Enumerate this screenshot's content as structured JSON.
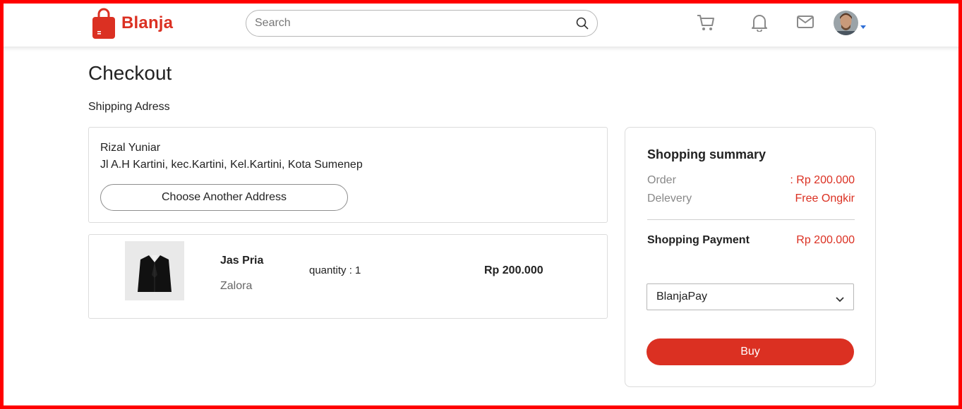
{
  "brand": {
    "name": "Blanja",
    "accent_color": "#db3022"
  },
  "search": {
    "placeholder": "Search",
    "value": ""
  },
  "header_icons": [
    "cart-icon",
    "bell-icon",
    "mail-icon"
  ],
  "page": {
    "title": "Checkout",
    "section_label": "Shipping Adress"
  },
  "address": {
    "name": "Rizal Yuniar",
    "line": "Jl A.H Kartini, kec.Kartini, Kel.Kartini, Kota Sumenep",
    "choose_button": "Choose Another Address"
  },
  "item": {
    "name": "Jas Pria",
    "store": "Zalora",
    "quantity": "quantity : 1",
    "price": "Rp 200.000"
  },
  "summary": {
    "title": "Shopping summary",
    "order_label": "Order",
    "order_value": ": Rp 200.000",
    "delivery_label": "Delevery",
    "delivery_value": "Free Ongkir",
    "payment_label": "Shopping Payment",
    "payment_value": "Rp 200.000",
    "payment_method": "BlanjaPay",
    "buy_label": "Buy"
  }
}
